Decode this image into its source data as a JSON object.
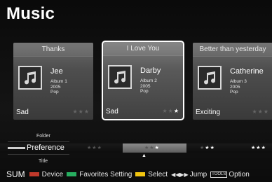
{
  "app": {
    "title": "Music"
  },
  "cards": [
    {
      "track": "Thanks",
      "artist": "Jee",
      "album": "Album 1",
      "year": "2005",
      "genre": "Pop",
      "mood": "Sad",
      "rating": 0,
      "selected": false
    },
    {
      "track": "I Love You",
      "artist": "Darby",
      "album": "Album 2",
      "year": "2005",
      "genre": "Pop",
      "mood": "Sad",
      "rating": 1,
      "selected": true
    },
    {
      "track": "Better than yesterday",
      "artist": "Catherine",
      "album": "Album 3",
      "year": "2005",
      "genre": "Pop",
      "mood": "Exciting",
      "rating": 0,
      "selected": false
    }
  ],
  "sort": {
    "above": "Folder",
    "current": "Preference",
    "below": "Title"
  },
  "rating_band": [
    {
      "rating": 0
    },
    {
      "rating": 1
    },
    {
      "rating": 2
    },
    {
      "rating": 3
    }
  ],
  "footer": {
    "mode": "SUM",
    "buttons": [
      {
        "label": "Device",
        "color": "#c0392b"
      },
      {
        "label": "Favorites Setting",
        "color": "#27ae60"
      },
      {
        "label": "Select",
        "color": "#f1c40f"
      }
    ],
    "jump_label": "Jump",
    "tools_label": "TOOLS",
    "option_label": "Option"
  },
  "icons": {
    "album_art": "music-note-icon",
    "jump": "rewind-fastforward-icon"
  }
}
